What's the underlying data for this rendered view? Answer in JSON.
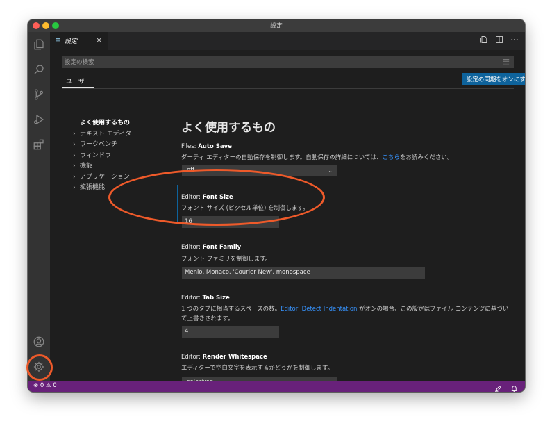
{
  "window": {
    "title": "設定"
  },
  "activity_bar": {
    "icons": [
      "files-icon",
      "search-icon",
      "source-control-icon",
      "run-debug-icon",
      "extensions-icon",
      "account-icon",
      "gear-icon"
    ]
  },
  "tab": {
    "label": "設定",
    "close": "×"
  },
  "search": {
    "placeholder": "設定の検索"
  },
  "scope_tab": "ユーザー",
  "sync_button": "設定の同期をオンにする",
  "toc": {
    "active": "よく使用するもの",
    "items": [
      "テキスト エディター",
      "ワークベンチ",
      "ウィンドウ",
      "機能",
      "アプリケーション",
      "拡張機能"
    ]
  },
  "section_heading": "よく使用するもの",
  "settings": {
    "auto_save": {
      "prefix": "Files: ",
      "name": "Auto Save",
      "desc_before": "ダーティ エディターの自動保存を制御します。自動保存の詳細については、",
      "desc_link": "こちら",
      "desc_after": "をお読みください。",
      "value": "off"
    },
    "font_size": {
      "prefix": "Editor: ",
      "name": "Font Size",
      "desc": "フォント サイズ (ピクセル単位) を制御します。",
      "value": "16"
    },
    "font_family": {
      "prefix": "Editor: ",
      "name": "Font Family",
      "desc": "フォント ファミリを制御します。",
      "value": "Menlo, Monaco, 'Courier New', monospace"
    },
    "tab_size": {
      "prefix": "Editor: ",
      "name": "Tab Size",
      "desc_before": "1 つのタブに相当するスペースの数。",
      "desc_link": "Editor: Detect Indentation",
      "desc_after": " がオンの場合、この設定はファイル コンテンツに基づい",
      "desc_line2": "て上書きされます。",
      "value": "4"
    },
    "render_whitespace": {
      "prefix": "Editor: ",
      "name": "Render Whitespace",
      "desc": "エディターで空白文字を表示するかどうかを制御します。",
      "value": "selection"
    }
  },
  "status_bar": {
    "errors": "0",
    "warnings": "0"
  },
  "colors": {
    "accent": "#0e639c",
    "status_bar": "#68217a",
    "annotation": "#ee5a2a",
    "link": "#3794ff"
  }
}
